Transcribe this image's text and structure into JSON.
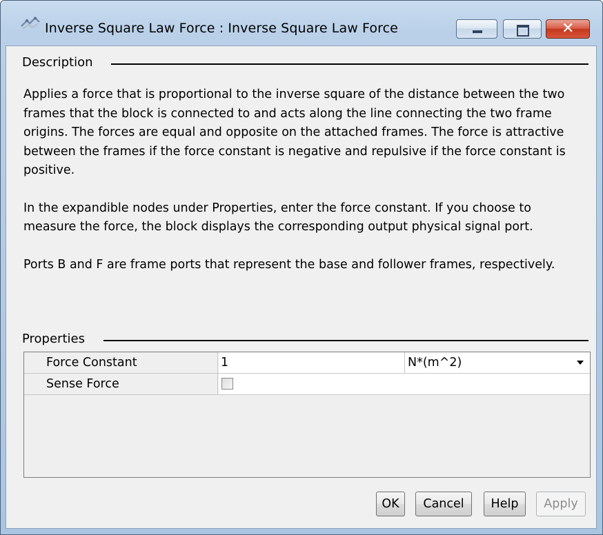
{
  "window": {
    "title": "Inverse Square Law Force : Inverse Square Law Force",
    "app_icon": "simscape-block-icon"
  },
  "description": {
    "heading": "Description",
    "paragraphs": [
      "Applies a force that is proportional to the inverse square of the distance between the two frames that the block is connected to and acts along the line connecting the two frame origins. The forces are equal and opposite on the attached frames. The force is attractive between the frames if the force constant is negative and repulsive if the force constant is positive.",
      "In the expandible nodes under Properties, enter the force constant. If you choose to measure the force, the block displays the corresponding output physical signal port.",
      "Ports B and F are frame ports that represent the base and follower frames, respectively."
    ]
  },
  "properties": {
    "heading": "Properties",
    "rows": [
      {
        "name": "Force Constant",
        "value": "1",
        "unit": "N*(m^2)"
      },
      {
        "name": "Sense Force",
        "checked": false
      }
    ]
  },
  "buttons": {
    "ok": "OK",
    "cancel": "Cancel",
    "help": "Help",
    "apply": "Apply"
  },
  "colors": {
    "title_bar": "#b9d0e8",
    "client_bg": "#f0f0f0",
    "close_button": "#c4381f",
    "disabled_text": "#8d8d8d"
  }
}
